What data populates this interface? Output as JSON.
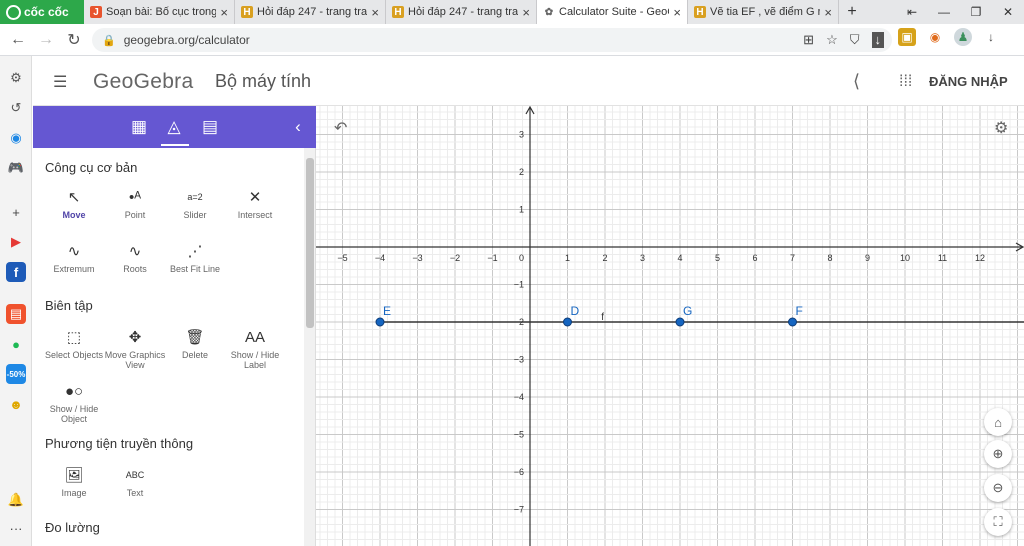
{
  "browser": {
    "brand": "cốc cốc",
    "tabs": [
      {
        "label": "Soạn bài: Bố cục trong",
        "fav": "J",
        "favcolor": "#e8542e"
      },
      {
        "label": "Hỏi đáp 247 - trang tra",
        "fav": "H",
        "favcolor": "#d9a021"
      },
      {
        "label": "Hỏi đáp 247 - trang tra",
        "fav": "H",
        "favcolor": "#d9a021"
      },
      {
        "label": "Calculator Suite - GeoG",
        "fav": "✿",
        "favcolor": "#666666",
        "active": true
      },
      {
        "label": "Vẽ tia EF , vẽ điểm G n",
        "fav": "H",
        "favcolor": "#d9a021"
      }
    ],
    "url": "geogebra.org/calculator"
  },
  "app": {
    "logo": "GeoGebra",
    "title": "Bộ máy tính",
    "login": "ĐĂNG NHẬP"
  },
  "panel": {
    "categories": [
      {
        "title": "Công cụ cơ bản",
        "tools": [
          {
            "label": "Move",
            "icon": "↖",
            "selected": true
          },
          {
            "label": "Point",
            "icon": "•ᴬ"
          },
          {
            "label": "Slider",
            "icon": "a=2"
          },
          {
            "label": "Intersect",
            "icon": "✕"
          },
          {
            "label": "Extremum",
            "icon": "∿"
          },
          {
            "label": "Roots",
            "icon": "∿"
          },
          {
            "label": "Best Fit Line",
            "icon": "⋰"
          }
        ]
      },
      {
        "title": "Biên tập",
        "tools": [
          {
            "label": "Select Objects",
            "icon": "⬚"
          },
          {
            "label": "Move Graphics View",
            "icon": "✥"
          },
          {
            "label": "Delete",
            "icon": "🗑"
          },
          {
            "label": "Show / Hide Label",
            "icon": "AA"
          },
          {
            "label": "Show / Hide Object",
            "icon": "●○"
          }
        ]
      },
      {
        "title": "Phương tiện truyền thông",
        "tools": [
          {
            "label": "Image",
            "icon": "🖼"
          },
          {
            "label": "Text",
            "icon": "ABC"
          }
        ]
      },
      {
        "title": "Đo lường",
        "tools": []
      }
    ]
  },
  "graph": {
    "x_ticks": [
      -5,
      -4,
      -3,
      -2,
      -1,
      1,
      2,
      3,
      4,
      5,
      6,
      7,
      8,
      9,
      10,
      11,
      12
    ],
    "y_ticks": [
      3,
      2,
      1,
      -1,
      -2,
      -3,
      -4,
      -5,
      -6,
      -7
    ],
    "origin_label": "0",
    "line_label": "f",
    "line_y": -2,
    "points": [
      {
        "name": "E",
        "x": -4,
        "y": -2
      },
      {
        "name": "D",
        "x": 1,
        "y": -2
      },
      {
        "name": "G",
        "x": 4,
        "y": -2
      },
      {
        "name": "F",
        "x": 7,
        "y": -2
      }
    ],
    "point_color": "#1565c0"
  }
}
